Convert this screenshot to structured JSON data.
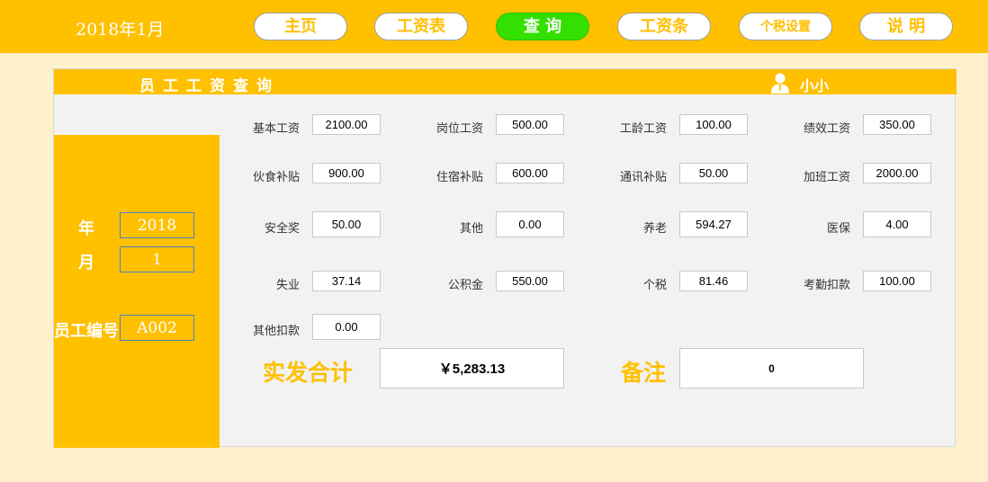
{
  "header": {
    "period": "2018年1月",
    "nav": [
      {
        "label": "主页"
      },
      {
        "label": "工资表"
      },
      {
        "label": "查 询"
      },
      {
        "label": "工资条"
      },
      {
        "label": "个税设置"
      },
      {
        "label": "说 明"
      }
    ],
    "active_nav": "查 询"
  },
  "panel": {
    "title": "员工工资查询",
    "user": "小小",
    "user_icon": "person-icon"
  },
  "query": {
    "year_label": "年",
    "year": "2018",
    "month_label": "月",
    "month": "1",
    "employee_id_label": "员工编号",
    "employee_id": "A002"
  },
  "fields": [
    {
      "label": "基本工资",
      "value": "2100.00"
    },
    {
      "label": "岗位工资",
      "value": "500.00"
    },
    {
      "label": "工龄工资",
      "value": "100.00"
    },
    {
      "label": "绩效工资",
      "value": "350.00"
    },
    {
      "label": "伙食补贴",
      "value": "900.00"
    },
    {
      "label": "住宿补贴",
      "value": "600.00"
    },
    {
      "label": "通讯补贴",
      "value": "50.00"
    },
    {
      "label": "加班工资",
      "value": "2000.00"
    },
    {
      "label": "安全奖",
      "value": "50.00"
    },
    {
      "label": "其他",
      "value": "0.00"
    },
    {
      "label": "养老",
      "value": "594.27"
    },
    {
      "label": "医保",
      "value": "4.00"
    },
    {
      "label": "失业",
      "value": "37.14"
    },
    {
      "label": "公积金",
      "value": "550.00"
    },
    {
      "label": "个税",
      "value": "81.46"
    },
    {
      "label": "考勤扣款",
      "value": "100.00"
    },
    {
      "label": "其他扣款",
      "value": "0.00"
    }
  ],
  "summary": {
    "net_pay_label": "实发合计",
    "net_pay": "￥5,283.13",
    "remark_label": "备注",
    "remark": "0"
  },
  "colors": {
    "accent": "#FFC000",
    "active_tab": "#33E000",
    "page_bg": "#FFF0CC",
    "panel_bg": "#F2F2F2"
  }
}
